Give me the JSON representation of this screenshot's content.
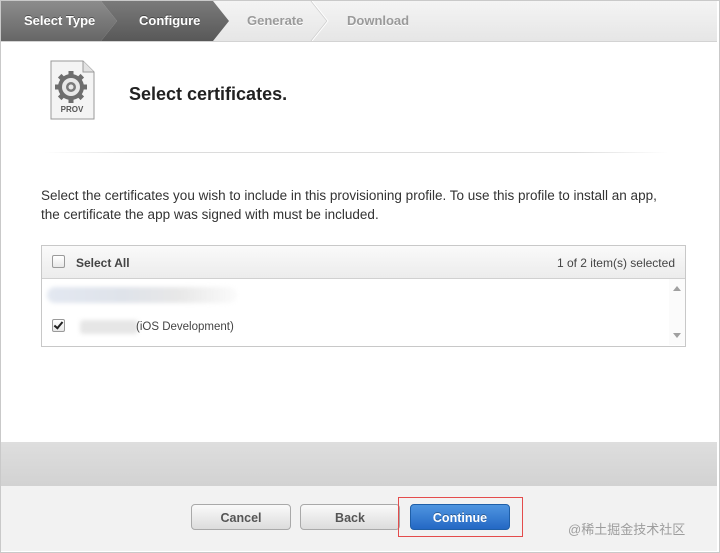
{
  "steps": [
    {
      "label": "Select Type",
      "state": "done"
    },
    {
      "label": "Configure",
      "state": "active"
    },
    {
      "label": "Generate",
      "state": "pending"
    },
    {
      "label": "Download",
      "state": "pending"
    }
  ],
  "header": {
    "icon_label": "PROV",
    "title": "Select certificates."
  },
  "description": "Select the certificates you wish to include in this provisioning profile. To use this profile to install an app, the certificate the app was signed with must be included.",
  "certificates": {
    "select_all_label": "Select All",
    "selected_count": "1 of 2 item(s) selected",
    "items": [
      {
        "name": "",
        "checked": false
      },
      {
        "name": "(iOS Development)",
        "checked": true
      }
    ]
  },
  "buttons": {
    "cancel": "Cancel",
    "back": "Back",
    "continue": "Continue"
  },
  "watermark": "@稀土掘金技术社区",
  "colors": {
    "primary_button": "#2468c4",
    "highlight": "#e44c4c"
  }
}
